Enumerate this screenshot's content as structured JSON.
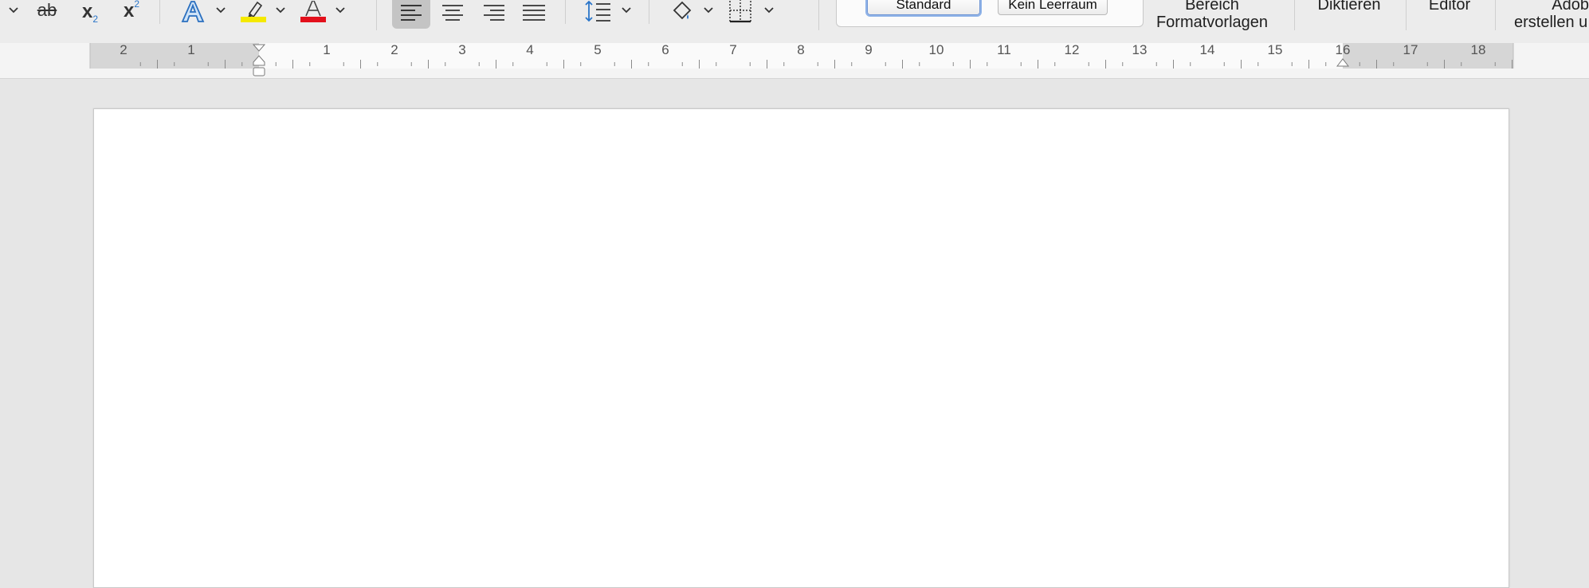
{
  "toolbar": {
    "strikethrough_label": "ab",
    "subscript_label": "x",
    "subscript_index": "2",
    "superscript_label": "x",
    "superscript_index": "2",
    "text_effects_label": "A",
    "font_color_label": "A",
    "highlight_color": "#f5e900",
    "font_color": "#e3101c"
  },
  "styles": {
    "items": [
      {
        "label": "Standard",
        "selected": true
      },
      {
        "label": "Kein Leerraum",
        "selected": false
      }
    ]
  },
  "commands": {
    "styles_pane_line1": "Bereich",
    "styles_pane_line2": "Formatvorlagen",
    "dictate": "Diktieren",
    "editor": "Editor",
    "adobe_line1": "Adob",
    "adobe_line2": "erstellen u"
  },
  "ruler": {
    "labels": [
      "2",
      "1",
      "1",
      "2",
      "3",
      "4",
      "5",
      "6",
      "7",
      "8",
      "9",
      "10",
      "11",
      "12",
      "13",
      "14",
      "15",
      "16",
      "17",
      "18"
    ]
  },
  "colors": {
    "accent": "#2a75c9"
  }
}
